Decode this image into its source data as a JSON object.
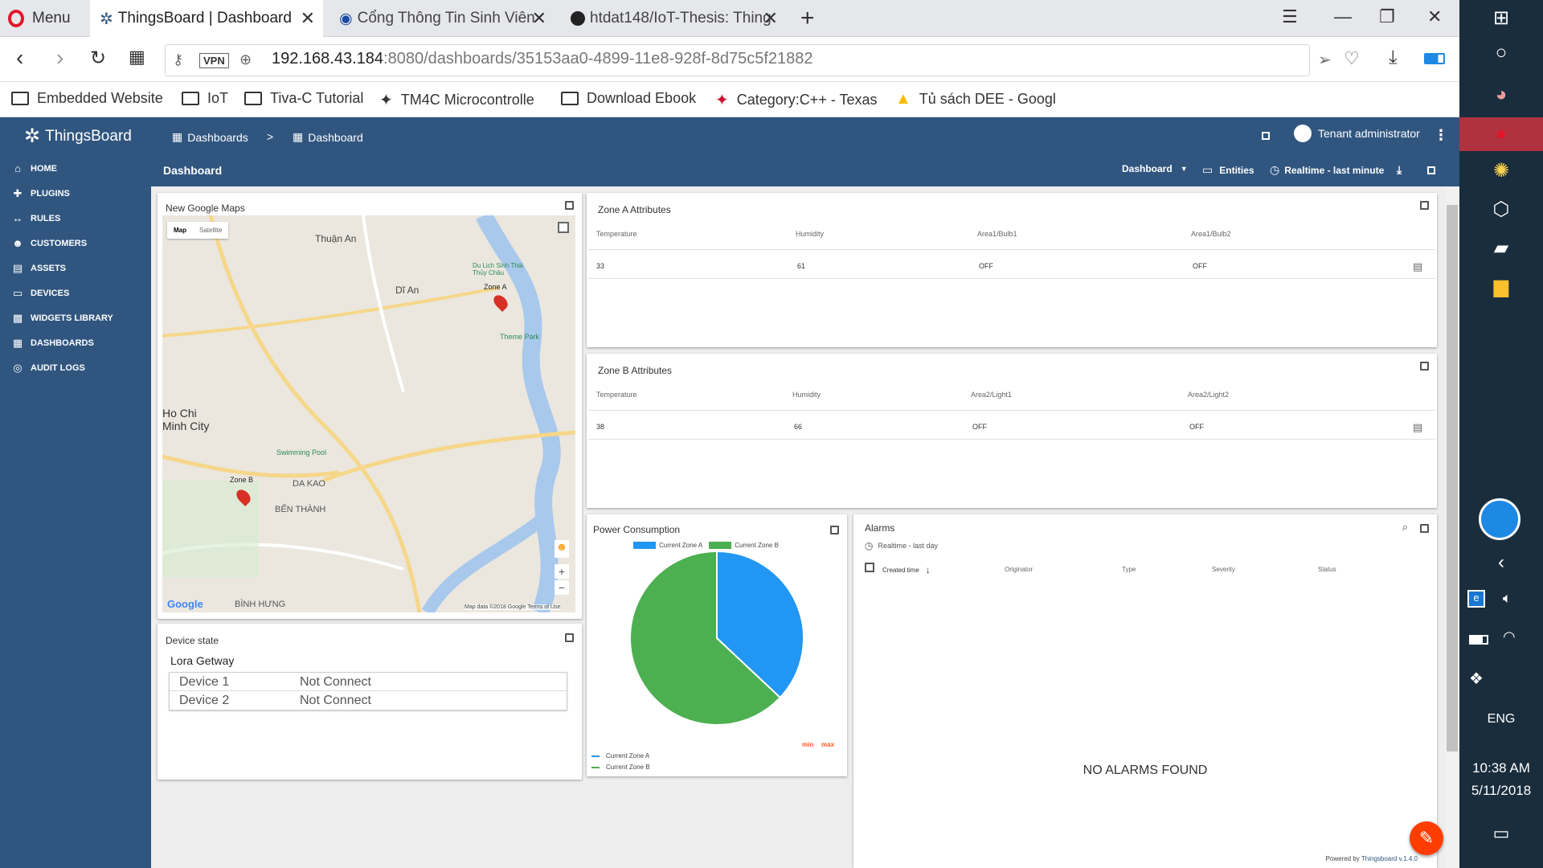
{
  "browser": {
    "menu_label": "Menu",
    "tabs": [
      {
        "title": "ThingsBoard | Dashboard"
      },
      {
        "title": "Cổng Thông Tin Sinh Viên"
      },
      {
        "title": "htdat148/IoT-Thesis: Thing"
      }
    ],
    "vpn": "VPN",
    "url_host": "192.168.43.184",
    "url_rest": ":8080/dashboards/35153aa0-4899-11e8-928f-8d75c5f21882",
    "bookmarks": [
      {
        "label": "Embedded Website",
        "icon": "folder-icon"
      },
      {
        "label": "IoT",
        "icon": "folder-icon"
      },
      {
        "label": "Tiva-C Tutorial",
        "icon": "folder-icon"
      },
      {
        "label": "TM4C Microcontrolle",
        "icon": "ti-logo-icon"
      },
      {
        "label": "Download Ebook",
        "icon": "folder-icon"
      },
      {
        "label": "Category:C++ - Texas",
        "icon": "ti-logo-icon"
      },
      {
        "label": "Tủ sách DEE - Google",
        "icon": "google-drive-icon"
      }
    ]
  },
  "app": {
    "logo": "ThingsBoard",
    "crumb1": "Dashboards",
    "crumb_sep": ">",
    "crumb2": "Dashboard",
    "user": "Tenant administrator",
    "dash_title": "Dashboard",
    "ctrl_dashboard": "Dashboard",
    "ctrl_entities": "Entities",
    "ctrl_time": "Realtime - last minute",
    "colors": {
      "primary": "#305680",
      "fab": "#ff3d00",
      "zoneA": "#2196f3",
      "zoneB": "#4caf50"
    }
  },
  "sidebar": {
    "items": [
      {
        "label": "HOME",
        "icon": "home-icon"
      },
      {
        "label": "PLUGINS",
        "icon": "plugin-icon"
      },
      {
        "label": "RULES",
        "icon": "rules-icon"
      },
      {
        "label": "CUSTOMERS",
        "icon": "customers-icon"
      },
      {
        "label": "ASSETS",
        "icon": "assets-icon"
      },
      {
        "label": "DEVICES",
        "icon": "devices-icon"
      },
      {
        "label": "WIDGETS LIBRARY",
        "icon": "widgets-icon"
      },
      {
        "label": "DASHBOARDS",
        "icon": "dashboards-icon"
      },
      {
        "label": "AUDIT LOGS",
        "icon": "audit-icon"
      }
    ]
  },
  "map": {
    "title": "New Google Maps",
    "btn_map": "Map",
    "btn_satellite": "Satellite",
    "labels": [
      "Thuận An",
      "Dĩ An",
      "Ho Chi Minh City",
      "Zone A",
      "Zone B",
      "DA KAO",
      "BẾN THÀNH",
      "Theme Park",
      "Swimming Pool",
      "BÌNH HƯNG",
      "Du Lịch Sinh Thái Thủy Châu"
    ],
    "google": "Google",
    "attribution": "Map data ©2018 Google   Terms of Use"
  },
  "zoneA": {
    "title": "Zone A Attributes",
    "headers": [
      "Temperature",
      "Humidity",
      "Area1/Bulb1",
      "Area1/Bulb2"
    ],
    "row": [
      "33",
      "61",
      "OFF",
      "OFF"
    ]
  },
  "zoneB": {
    "title": "Zone B Attributes",
    "headers": [
      "Temperature",
      "Humidity",
      "Area2/Light1",
      "Area2/Light2"
    ],
    "row": [
      "38",
      "66",
      "OFF",
      "OFF"
    ]
  },
  "device_state": {
    "title": "Device state",
    "gateway": "Lora Getway",
    "devices": [
      {
        "name": "Device 1",
        "status": "Not Connect"
      },
      {
        "name": "Device 2",
        "status": "Not Connect"
      }
    ]
  },
  "power": {
    "title": "Power Consumption",
    "legend_min": "min",
    "legend_max": "max"
  },
  "chart_data": {
    "type": "pie",
    "title": "Power Consumption",
    "series": [
      {
        "name": "Current Zone A",
        "value": 37,
        "color": "#2196f3"
      },
      {
        "name": "Current Zone B",
        "value": 63,
        "color": "#4caf50"
      }
    ],
    "legend_placement": "top"
  },
  "alarms": {
    "title": "Alarms",
    "timewindow": "Realtime - last day",
    "headers": [
      "Created time",
      "Originator",
      "Type",
      "Severity",
      "Status"
    ],
    "empty": "NO ALARMS FOUND",
    "powered": "Powered by",
    "powered_link": "Thingsboard v.1.4.0"
  },
  "taskbar": {
    "lang": "ENG",
    "time": "10:38 AM",
    "date": "5/11/2018"
  }
}
